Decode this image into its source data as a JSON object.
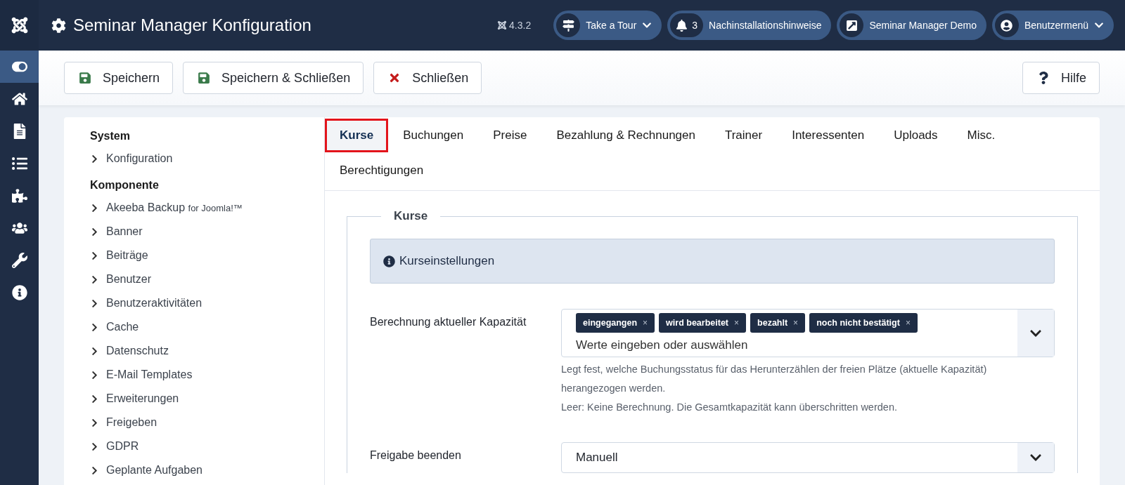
{
  "header": {
    "title": "Seminar Manager Konfiguration",
    "version": "4.3.2",
    "actions": [
      {
        "kind": "tour",
        "label": "Take a Tour"
      },
      {
        "kind": "notice",
        "count": "3",
        "label": "Nachinstallationshinweise"
      },
      {
        "kind": "external",
        "label": "Seminar Manager Demo"
      },
      {
        "kind": "user",
        "label": "Benutzermenü"
      }
    ]
  },
  "sidebar": {
    "items": [
      {
        "kind": "toggle",
        "selected": true
      },
      {
        "kind": "home",
        "selected": false
      },
      {
        "kind": "file",
        "selected": false
      },
      {
        "kind": "list",
        "selected": false
      },
      {
        "kind": "puzzle",
        "selected": false
      },
      {
        "kind": "users",
        "selected": false
      },
      {
        "kind": "wrench",
        "selected": false
      },
      {
        "kind": "info",
        "selected": false
      }
    ]
  },
  "toolbar": {
    "buttons": [
      {
        "kind": "save",
        "label": "Speichern"
      },
      {
        "kind": "save",
        "label": "Speichern & Schließen"
      },
      {
        "kind": "close",
        "label": "Schließen"
      }
    ],
    "help": "Hilfe"
  },
  "nav": {
    "groups": [
      {
        "title": "System",
        "items": [
          {
            "label": "Konfiguration"
          }
        ]
      },
      {
        "title": "Komponente",
        "items": [
          {
            "label": "Akeeba Backup",
            "suffix": "for Joomla!™"
          },
          {
            "label": "Banner"
          },
          {
            "label": "Beiträge"
          },
          {
            "label": "Benutzer"
          },
          {
            "label": "Benutzeraktivitäten"
          },
          {
            "label": "Cache"
          },
          {
            "label": "Datenschutz"
          },
          {
            "label": "E-Mail Templates"
          },
          {
            "label": "Erweiterungen"
          },
          {
            "label": "Freigeben"
          },
          {
            "label": "GDPR"
          },
          {
            "label": "Geplante Aufgaben"
          }
        ]
      }
    ]
  },
  "tabs": [
    {
      "label": "Kurse",
      "selected": true
    },
    {
      "label": "Buchungen",
      "selected": false
    },
    {
      "label": "Preise",
      "selected": false
    },
    {
      "label": "Bezahlung & Rechnungen",
      "selected": false
    },
    {
      "label": "Trainer",
      "selected": false
    },
    {
      "label": "Interessenten",
      "selected": false
    },
    {
      "label": "Uploads",
      "selected": false
    },
    {
      "label": "Misc.",
      "selected": false
    },
    {
      "label": "Berechtigungen",
      "selected": false
    }
  ],
  "fieldset": {
    "legend": "Kurse",
    "info": "Kurseinstellungen",
    "fields": [
      {
        "kind": "multi",
        "label": "Berechnung aktueller Kapazität",
        "tags": [
          {
            "label": "eingegangen",
            "remove": "×"
          },
          {
            "label": "wird bearbeitet",
            "remove": "×"
          },
          {
            "label": "bezahlt",
            "remove": "×"
          },
          {
            "label": "noch nicht bestätigt",
            "remove": "×"
          }
        ],
        "placeholder": "Werte eingeben oder auswählen",
        "help": [
          "Legt fest, welche Buchungsstatus für das Herunterzählen der freien Plätze (aktuelle Kapazität) herangezogen werden.",
          "Leer: Keine Berechnung. Die Gesamtkapazität kann überschritten werden."
        ]
      },
      {
        "kind": "select",
        "label": "Freigabe beenden",
        "value": "Manuell"
      }
    ]
  }
}
